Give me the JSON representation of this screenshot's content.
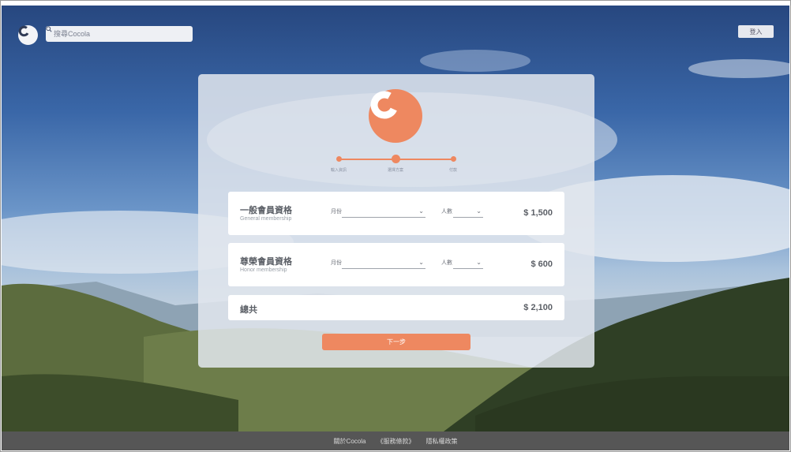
{
  "header": {
    "search_placeholder": "搜尋Cocola",
    "login_label": "登入"
  },
  "stepper": {
    "steps": [
      "輸入資訊",
      "選擇方案",
      "付款"
    ],
    "current_step": 2
  },
  "plans": [
    {
      "title": "一般會員資格",
      "subtitle": "General membership",
      "month_label": "月份",
      "people_label": "人數",
      "price": "$ 1,500"
    },
    {
      "title": "尊榮會員資格",
      "subtitle": "Honor membership",
      "month_label": "月份",
      "people_label": "人數",
      "price": "$ 600"
    }
  ],
  "total": {
    "label": "總共",
    "price": "$ 2,100"
  },
  "next_label": "下一步",
  "footer": {
    "links": [
      "關於Cocola",
      "《服務條款》",
      "隱私權政策"
    ]
  },
  "colors": {
    "accent": "#ee8860",
    "footer_bg": "#565656"
  },
  "icons": {
    "search": "search-icon",
    "logo": "cocola-logo-icon",
    "dropdown": "chevron-down-icon"
  }
}
